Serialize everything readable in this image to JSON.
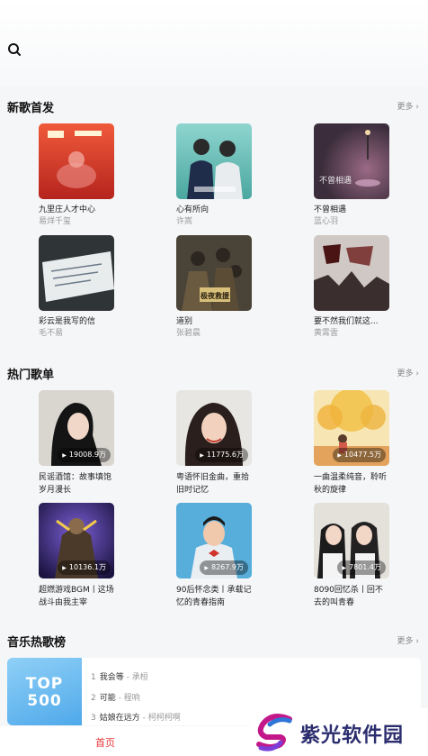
{
  "sections": {
    "new_songs": {
      "title": "新歌首发",
      "more": "更多"
    },
    "hot_playlists": {
      "title": "热门歌单",
      "more": "更多"
    },
    "charts": {
      "title": "音乐热歌榜",
      "more": "更多"
    }
  },
  "new_songs": [
    {
      "title": "九里庄人才中心",
      "artist": "易烊千玺",
      "cover_text": ""
    },
    {
      "title": "心有所向",
      "artist": "许嵩",
      "cover_text": ""
    },
    {
      "title": "不曾相遇",
      "artist": "蓝心羽",
      "cover_text": "不曾相遇"
    },
    {
      "title": "彩云是我写的信",
      "artist": "毛不易",
      "cover_text": ""
    },
    {
      "title": "道别",
      "artist": "张碧晨",
      "cover_text": "极夜救援"
    },
    {
      "title": "要不然我们就这...",
      "artist": "黄霄雲",
      "cover_text": ""
    }
  ],
  "playlists": [
    {
      "title": "民谣酒馆：故事填饱岁月漫长",
      "plays": "19008.9万"
    },
    {
      "title": "粤语怀旧金曲，重拾旧时记忆",
      "plays": "11775.6万"
    },
    {
      "title": "一曲温柔纯音，聆听秋的旋律",
      "plays": "10477.5万"
    },
    {
      "title": "超燃游戏BGM丨这场战斗由我主宰",
      "plays": "10136.1万"
    },
    {
      "title": "90后怀念类丨承载记忆的青春指南",
      "plays": "8267.9万"
    },
    {
      "title": "8090回忆杀丨回不去的叫青春",
      "plays": "7801.4万"
    }
  ],
  "chart": {
    "badge_line1": "TOP",
    "badge_line2": "500",
    "items": [
      {
        "rank": "1",
        "song": "我会等",
        "artist": "承桓"
      },
      {
        "rank": "2",
        "song": "可能",
        "artist": "程响"
      },
      {
        "rank": "3",
        "song": "姑娘在远方",
        "artist": "柯柯柯啊"
      }
    ]
  },
  "nav": {
    "home": "首页"
  },
  "watermark": {
    "text": "紫光软件园"
  },
  "colors": {
    "accent": "#e7373a",
    "chart_badge": "#5aaeea",
    "watermark": "#2b2d6e"
  }
}
